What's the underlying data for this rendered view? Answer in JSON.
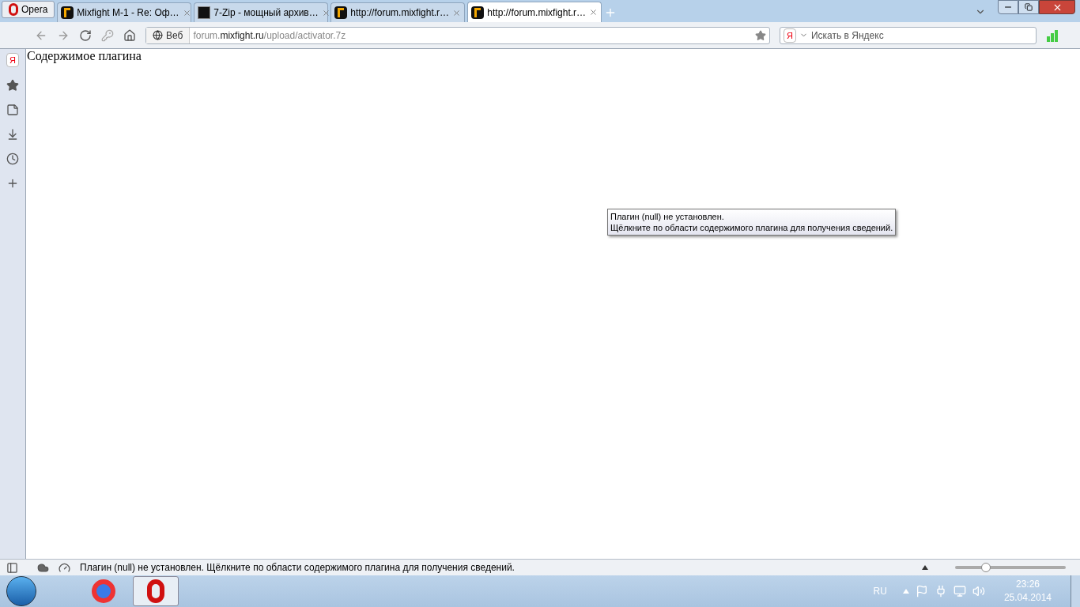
{
  "menu_button": {
    "label": "Opera"
  },
  "tabs": [
    {
      "title": "Mixfight M-1 - Re: Оф…",
      "kind": "site",
      "selected": false
    },
    {
      "title": "7-Zip - мощный архив…",
      "kind": "archive",
      "selected": false
    },
    {
      "title": "http://forum.mixfight.r…",
      "kind": "site",
      "selected": false
    },
    {
      "title": "http://forum.mixfight.r…",
      "kind": "site",
      "selected": true
    }
  ],
  "address_bar": {
    "badge": "Веб",
    "url": "forum.**mixfight.ru**/upload/activator.7z"
  },
  "search": {
    "engine": "Я",
    "placeholder": "Искать в Яндекс"
  },
  "sidebar": {
    "badge": "Я"
  },
  "page": {
    "text": "Содержимое плагина"
  },
  "tooltip": {
    "lines": [
      "Плагин (null) не установлен.",
      "Щёлкните по области содержимого плагина для получения сведений."
    ]
  },
  "status_bar": {
    "text": "Плагин (null) не установлен. Щёлкните по области содержимого плагина для получения сведений.",
    "zoom": {
      "level": 0.28
    }
  },
  "taskbar": {
    "language": "RU",
    "time": "23:26",
    "date": "25.04.2014",
    "apps": [
      {
        "kind": "chrome",
        "selected": false
      },
      {
        "kind": "opera",
        "selected": true
      }
    ]
  }
}
